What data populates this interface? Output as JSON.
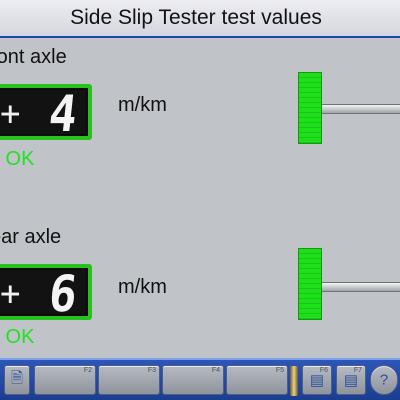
{
  "title": "Side Slip Tester test values",
  "front": {
    "label": "ront axle",
    "sign": "+",
    "value": "4",
    "unit": "m/km",
    "status": "k OK"
  },
  "rear": {
    "label": "ear axle",
    "sign": "+",
    "value": "6",
    "unit": "m/km",
    "status": "k OK"
  },
  "colors": {
    "accent_green": "#23e123",
    "title_border": "#1d46a8",
    "fkey_bar": "#2d56b8"
  },
  "fkeys": [
    {
      "label": "",
      "icon": "document-arrow-icon"
    },
    {
      "label": "F2",
      "icon": ""
    },
    {
      "label": "F3",
      "icon": ""
    },
    {
      "label": "F4",
      "icon": ""
    },
    {
      "label": "F5",
      "icon": ""
    },
    {
      "label": "F6",
      "icon": "page-icon"
    },
    {
      "label": "F7",
      "icon": "page-icon"
    },
    {
      "label": "",
      "icon": "help-icon"
    }
  ]
}
